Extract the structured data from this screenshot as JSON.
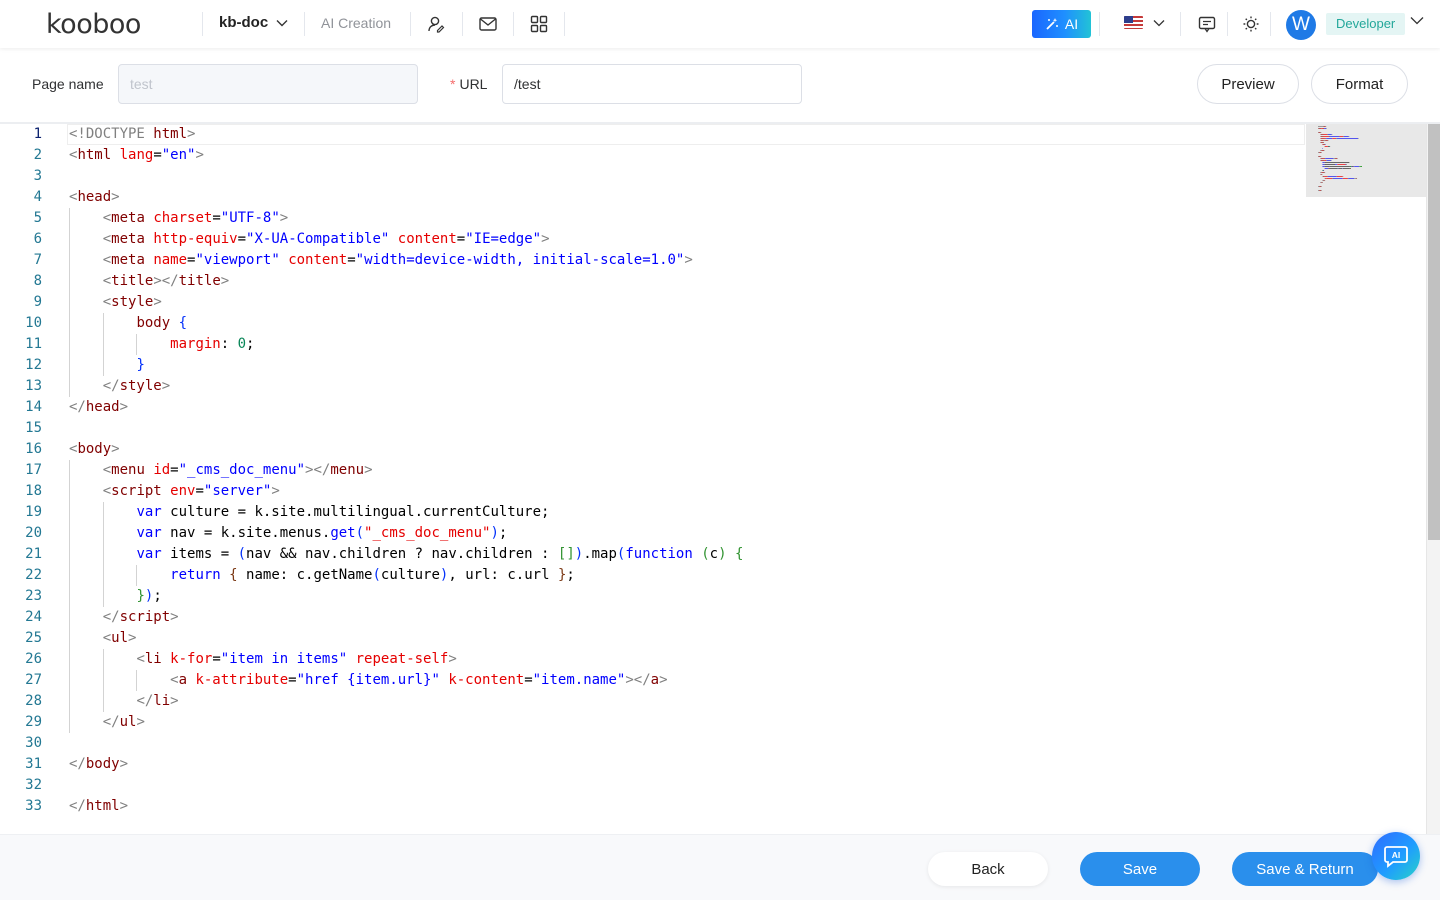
{
  "header": {
    "logo": "kooboo",
    "site": "kb-doc",
    "ai_creation": "AI Creation",
    "ai_button": "AI",
    "avatar_initial": "W",
    "role": "Developer"
  },
  "form": {
    "page_name_label": "Page name",
    "page_name_value": "test",
    "url_required": "*",
    "url_label": "URL",
    "url_value": "/test",
    "preview": "Preview",
    "format": "Format"
  },
  "editor": {
    "line_numbers": [
      "1",
      "2",
      "3",
      "4",
      "5",
      "6",
      "7",
      "8",
      "9",
      "10",
      "11",
      "12",
      "13",
      "14",
      "15",
      "16",
      "17",
      "18",
      "19",
      "20",
      "21",
      "22",
      "23",
      "24",
      "25",
      "26",
      "27",
      "28",
      "29",
      "30",
      "31",
      "32",
      "33"
    ],
    "lines": [
      [
        [
          "t-gray",
          "<!DOCTYPE "
        ],
        [
          "t-dt",
          "html"
        ],
        [
          "t-gray",
          ">"
        ]
      ],
      [
        [
          "t-gray",
          "<"
        ],
        [
          "t-tag",
          "html "
        ],
        [
          "t-attr",
          "lang"
        ],
        [
          "",
          "="
        ],
        [
          "t-str",
          "\"en\""
        ],
        [
          "t-gray",
          ">"
        ]
      ],
      [],
      [
        [
          "t-gray",
          "<"
        ],
        [
          "t-tag",
          "head"
        ],
        [
          "t-gray",
          ">"
        ]
      ],
      [
        [
          "",
          "    "
        ],
        [
          "t-gray",
          "<"
        ],
        [
          "t-tag",
          "meta "
        ],
        [
          "t-attr",
          "charset"
        ],
        [
          "",
          "="
        ],
        [
          "t-str",
          "\"UTF-8\""
        ],
        [
          "t-gray",
          ">"
        ]
      ],
      [
        [
          "",
          "    "
        ],
        [
          "t-gray",
          "<"
        ],
        [
          "t-tag",
          "meta "
        ],
        [
          "t-attr",
          "http-equiv"
        ],
        [
          "",
          "="
        ],
        [
          "t-str",
          "\"X-UA-Compatible\" "
        ],
        [
          "t-attr",
          "content"
        ],
        [
          "",
          "="
        ],
        [
          "t-str",
          "\"IE=edge\""
        ],
        [
          "t-gray",
          ">"
        ]
      ],
      [
        [
          "",
          "    "
        ],
        [
          "t-gray",
          "<"
        ],
        [
          "t-tag",
          "meta "
        ],
        [
          "t-attr",
          "name"
        ],
        [
          "",
          "="
        ],
        [
          "t-str",
          "\"viewport\" "
        ],
        [
          "t-attr",
          "content"
        ],
        [
          "",
          "="
        ],
        [
          "t-str",
          "\"width=device-width, initial-scale=1.0\""
        ],
        [
          "t-gray",
          ">"
        ]
      ],
      [
        [
          "",
          "    "
        ],
        [
          "t-gray",
          "<"
        ],
        [
          "t-tag",
          "title"
        ],
        [
          "t-gray",
          "></"
        ],
        [
          "t-tag",
          "title"
        ],
        [
          "t-gray",
          ">"
        ]
      ],
      [
        [
          "",
          "    "
        ],
        [
          "t-gray",
          "<"
        ],
        [
          "t-tag",
          "style"
        ],
        [
          "t-gray",
          ">"
        ]
      ],
      [
        [
          "",
          "        "
        ],
        [
          "t-tag",
          "body "
        ],
        [
          "t-br1",
          "{"
        ]
      ],
      [
        [
          "",
          "            "
        ],
        [
          "t-attr",
          "margin"
        ],
        [
          "",
          ": "
        ],
        [
          "t-num",
          "0"
        ],
        [
          "",
          ";"
        ]
      ],
      [
        [
          "",
          "        "
        ],
        [
          "t-br1",
          "}"
        ]
      ],
      [
        [
          "",
          "    "
        ],
        [
          "t-gray",
          "</"
        ],
        [
          "t-tag",
          "style"
        ],
        [
          "t-gray",
          ">"
        ]
      ],
      [
        [
          "t-gray",
          "</"
        ],
        [
          "t-tag",
          "head"
        ],
        [
          "t-gray",
          ">"
        ]
      ],
      [],
      [
        [
          "t-gray",
          "<"
        ],
        [
          "t-tag",
          "body"
        ],
        [
          "t-gray",
          ">"
        ]
      ],
      [
        [
          "",
          "    "
        ],
        [
          "t-gray",
          "<"
        ],
        [
          "t-tag",
          "menu "
        ],
        [
          "t-attr",
          "id"
        ],
        [
          "",
          "="
        ],
        [
          "t-str",
          "\"_cms_doc_menu\""
        ],
        [
          "t-gray",
          "></"
        ],
        [
          "t-tag",
          "menu"
        ],
        [
          "t-gray",
          ">"
        ]
      ],
      [
        [
          "",
          "    "
        ],
        [
          "t-gray",
          "<"
        ],
        [
          "t-tag",
          "script "
        ],
        [
          "t-attr",
          "env"
        ],
        [
          "",
          "="
        ],
        [
          "t-str",
          "\"server\""
        ],
        [
          "t-gray",
          ">"
        ]
      ],
      [
        [
          "",
          "        "
        ],
        [
          "t-kw",
          "var "
        ],
        [
          "",
          "culture = k.site.multilingual.currentCulture;"
        ]
      ],
      [
        [
          "",
          "        "
        ],
        [
          "t-kw",
          "var "
        ],
        [
          "",
          "nav = k.site.menus."
        ],
        [
          "t-kw",
          "get"
        ],
        [
          "t-br1",
          "("
        ],
        [
          "t-attr",
          "\"_cms_doc_menu\""
        ],
        [
          "t-br1",
          ")"
        ],
        [
          "",
          ";"
        ]
      ],
      [
        [
          "",
          "        "
        ],
        [
          "t-kw",
          "var "
        ],
        [
          "",
          "items = "
        ],
        [
          "t-br1",
          "("
        ],
        [
          "",
          "nav && nav.children ? nav.children : "
        ],
        [
          "t-br2",
          "[]"
        ],
        [
          "t-br1",
          ")"
        ],
        [
          "",
          ".map"
        ],
        [
          "t-br1",
          "("
        ],
        [
          "t-kw",
          "function "
        ],
        [
          "t-br2",
          "("
        ],
        [
          "",
          "c"
        ],
        [
          "t-br2",
          ") {"
        ]
      ],
      [
        [
          "",
          "            "
        ],
        [
          "t-kw",
          "return "
        ],
        [
          "t-br3",
          "{ "
        ],
        [
          "",
          "name: c.getName"
        ],
        [
          "t-br1",
          "("
        ],
        [
          "",
          "culture"
        ],
        [
          "t-br1",
          ")"
        ],
        [
          "",
          ", url: c.url "
        ],
        [
          "t-br3",
          "}"
        ],
        [
          "",
          ";"
        ]
      ],
      [
        [
          "",
          "        "
        ],
        [
          "t-br2",
          "}"
        ],
        [
          "t-br1",
          ")"
        ],
        [
          "",
          ";"
        ]
      ],
      [
        [
          "",
          "    "
        ],
        [
          "t-gray",
          "</"
        ],
        [
          "t-tag",
          "script"
        ],
        [
          "t-gray",
          ">"
        ]
      ],
      [
        [
          "",
          "    "
        ],
        [
          "t-gray",
          "<"
        ],
        [
          "t-tag",
          "ul"
        ],
        [
          "t-gray",
          ">"
        ]
      ],
      [
        [
          "",
          "        "
        ],
        [
          "t-gray",
          "<"
        ],
        [
          "t-tag",
          "li "
        ],
        [
          "t-attr",
          "k-for"
        ],
        [
          "",
          "="
        ],
        [
          "t-str",
          "\"item in items\" "
        ],
        [
          "t-attr",
          "repeat-self"
        ],
        [
          "t-gray",
          ">"
        ]
      ],
      [
        [
          "",
          "            "
        ],
        [
          "t-gray",
          "<"
        ],
        [
          "t-tag",
          "a "
        ],
        [
          "t-attr",
          "k-attribute"
        ],
        [
          "",
          "="
        ],
        [
          "t-str",
          "\"href {item.url}\" "
        ],
        [
          "t-attr",
          "k-content"
        ],
        [
          "",
          "="
        ],
        [
          "t-str",
          "\"item.name\""
        ],
        [
          "t-gray",
          "></"
        ],
        [
          "t-tag",
          "a"
        ],
        [
          "t-gray",
          ">"
        ]
      ],
      [
        [
          "",
          "        "
        ],
        [
          "t-gray",
          "</"
        ],
        [
          "t-tag",
          "li"
        ],
        [
          "t-gray",
          ">"
        ]
      ],
      [
        [
          "",
          "    "
        ],
        [
          "t-gray",
          "</"
        ],
        [
          "t-tag",
          "ul"
        ],
        [
          "t-gray",
          ">"
        ]
      ],
      [],
      [
        [
          "t-gray",
          "</"
        ],
        [
          "t-tag",
          "body"
        ],
        [
          "t-gray",
          ">"
        ]
      ],
      [],
      [
        [
          "t-gray",
          "</"
        ],
        [
          "t-tag",
          "html"
        ],
        [
          "t-gray",
          ">"
        ]
      ]
    ]
  },
  "footer": {
    "back": "Back",
    "save": "Save",
    "save_return": "Save & Return",
    "ai_float": "AI"
  },
  "icons": {
    "ai_creation": "magic-wand-icon",
    "user_manage": "user-edit-icon",
    "mail": "mail-icon",
    "apps": "apps-grid-icon",
    "language": "us-flag-icon",
    "notes": "message-board-icon",
    "theme": "sun-icon",
    "assistant": "ai-chat-icon"
  },
  "colors": {
    "primary": "#2a8fec",
    "ai_gradient_start": "#1a66ff",
    "ai_gradient_end": "#22c3d6",
    "role_badge_bg": "#e4f5f4",
    "role_badge_text": "#23a79a"
  }
}
